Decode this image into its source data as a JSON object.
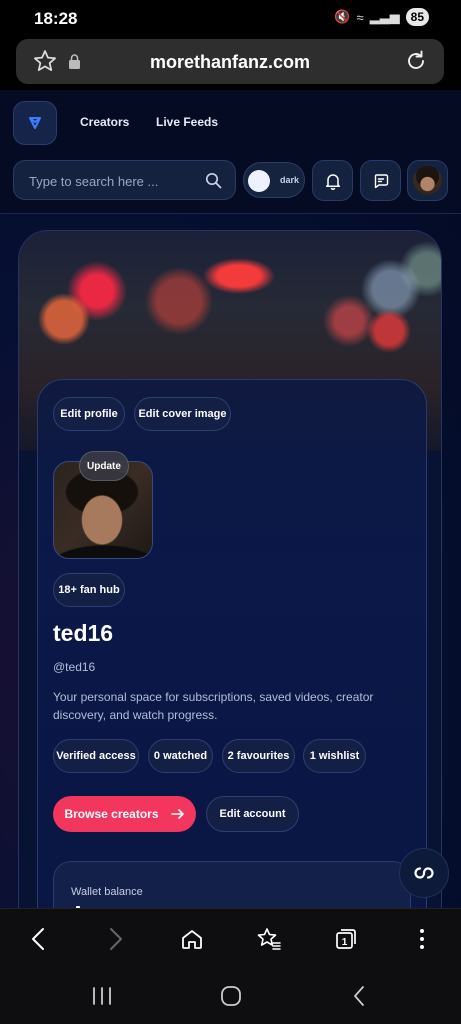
{
  "status_bar": {
    "time": "18:28",
    "battery": "85"
  },
  "browser": {
    "url": "morethanfanz.com"
  },
  "nav": {
    "links": [
      "Creators",
      "Live Feeds"
    ],
    "search_placeholder": "Type to search here ...",
    "theme_toggle_label": "dark"
  },
  "profile": {
    "actions": [
      "Edit profile",
      "Edit cover image"
    ],
    "update_label": "Update",
    "badge": "18+ fan hub",
    "username": "ted16",
    "handle": "@ted16",
    "bio": "Your personal space for subscriptions, saved videos, creator discovery, and watch progress.",
    "stats": [
      "Verified access",
      "0 watched",
      "2 favourites",
      "1 wishlist"
    ],
    "primary_cta": "Browse creators",
    "secondary_cta": "Edit account",
    "wallet_label": "Wallet balance"
  },
  "colors": {
    "accent": "#f2365e",
    "background": "#061033",
    "card": "#0b1848"
  },
  "icons": [
    "star-icon",
    "lock-icon",
    "reload-icon",
    "logo-icon",
    "search-icon",
    "bell-icon",
    "chat-icon",
    "arrow-right-icon",
    "infinity-icon",
    "back-icon",
    "forward-icon",
    "home-icon",
    "bookmarks-icon",
    "tabs-icon",
    "menu-icon",
    "recents-icon",
    "home-nav-icon",
    "back-nav-icon"
  ],
  "toolbar": {
    "tabs_count": "1"
  }
}
